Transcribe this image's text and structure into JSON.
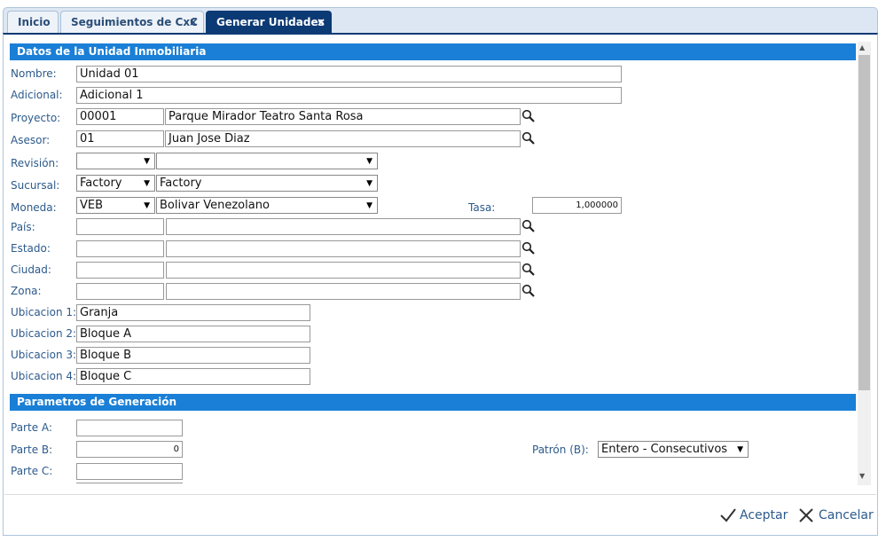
{
  "tabs": [
    {
      "label": "Inicio"
    },
    {
      "label": "Seguimientos de CxC",
      "close": "×"
    },
    {
      "label": "Generar Unidades",
      "close": "×"
    }
  ],
  "section1": {
    "title": "Datos de la Unidad Inmobiliaria",
    "nombre": {
      "label": "Nombre:",
      "value": "Unidad 01"
    },
    "adicional": {
      "label": "Adicional:",
      "value": "Adicional 1"
    },
    "proyecto": {
      "label": "Proyecto:",
      "code": "00001",
      "name": "Parque Mirador Teatro Santa Rosa"
    },
    "asesor": {
      "label": "Asesor:",
      "code": "01",
      "name": "Juan Jose Diaz"
    },
    "revision": {
      "label": "Revisión:",
      "code": "",
      "name": ""
    },
    "sucursal": {
      "label": "Sucursal:",
      "code": "Factory",
      "name": "Factory"
    },
    "moneda": {
      "label": "Moneda:",
      "code": "VEB",
      "name": "Bolivar Venezolano"
    },
    "tasa": {
      "label": "Tasa:",
      "value": "1,000000"
    },
    "pais": {
      "label": "País:",
      "code": "",
      "name": ""
    },
    "estado": {
      "label": "Estado:",
      "code": "",
      "name": ""
    },
    "ciudad": {
      "label": "Ciudad:",
      "code": "",
      "name": ""
    },
    "zona": {
      "label": "Zona:",
      "code": "",
      "name": ""
    },
    "ubicacion1": {
      "label": "Ubicacion 1:",
      "value": "Granja"
    },
    "ubicacion2": {
      "label": "Ubicacion 2:",
      "value": "Bloque A"
    },
    "ubicacion3": {
      "label": "Ubicacion 3:",
      "value": "Bloque B"
    },
    "ubicacion4": {
      "label": "Ubicacion 4:",
      "value": "Bloque C"
    }
  },
  "section2": {
    "title": "Parametros de Generación",
    "parteA": {
      "label": "Parte A:",
      "value": ""
    },
    "parteB": {
      "label": "Parte B:",
      "value": "0"
    },
    "parteC": {
      "label": "Parte C:",
      "value": ""
    },
    "patron": {
      "label": "Patrón (B):",
      "value": "Entero - Consecutivos"
    }
  },
  "footer": {
    "accept": "Aceptar",
    "cancel": "Cancelar"
  },
  "colors": {
    "header": "#1a7fd6",
    "active_tab": "#0c3a74",
    "label": "#2c5a8c"
  }
}
